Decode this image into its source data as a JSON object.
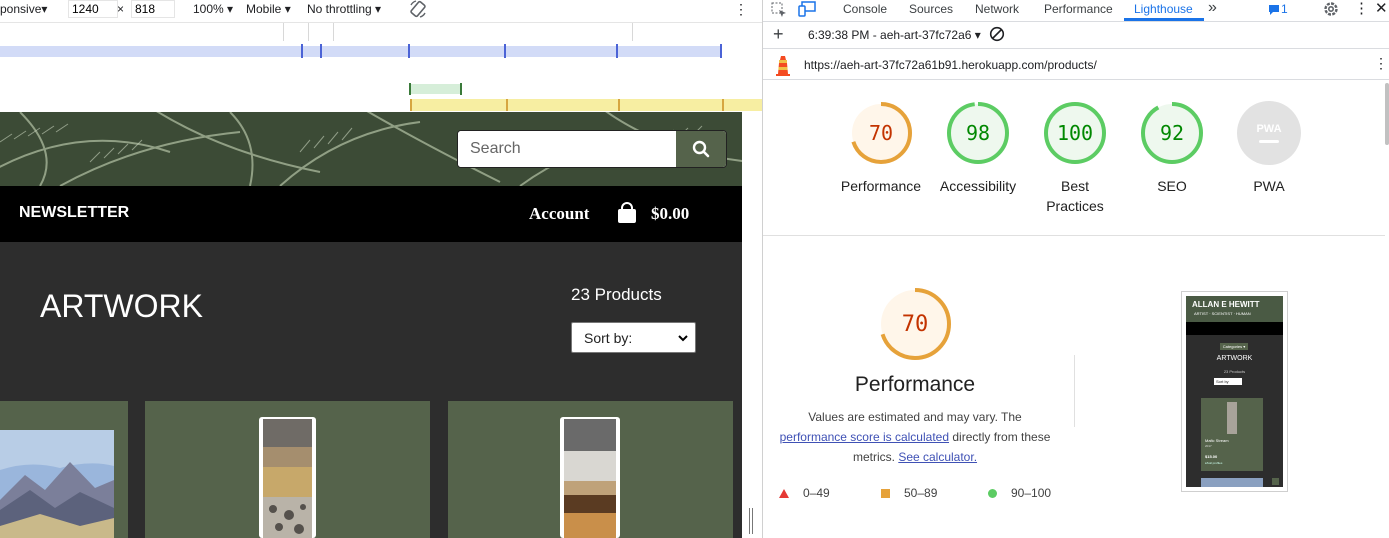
{
  "device_toolbar": {
    "dimensions_label": "ponsive",
    "width": "1240",
    "height": "818",
    "times": "×",
    "zoom": "100%",
    "device": "Mobile",
    "throttling": "No throttling",
    "arrow": "▾"
  },
  "site": {
    "search_placeholder": "Search",
    "nav_newsletter": "NEWSLETTER",
    "nav_account": "Account",
    "nav_total": "$0.00",
    "page_title": "ARTWORK",
    "product_count": "23 Products",
    "sort_label": "Sort by:"
  },
  "devtools": {
    "tabs": [
      "Console",
      "Sources",
      "Network",
      "Performance",
      "Lighthouse"
    ],
    "active_tab": "Lighthouse",
    "more_tabs": "»",
    "issues_count": "1",
    "report_selector": "6:39:38 PM - aeh-art-37fc72a6",
    "page_url": "https://aeh-art-37fc72a61b91.herokuapp.com/products/"
  },
  "lighthouse": {
    "scores": [
      {
        "label": "Performance",
        "value": "70",
        "fraction": 0.7,
        "color": "#e6a23a",
        "text_color": "#c33300",
        "bg": "#fff6ea"
      },
      {
        "label": "Accessibility",
        "value": "98",
        "fraction": 0.98,
        "color": "#5ccc63",
        "text_color": "#008800",
        "bg": "#eef8ee"
      },
      {
        "label": "Best Practices",
        "value": "100",
        "fraction": 1.0,
        "color": "#5ccc63",
        "text_color": "#008800",
        "bg": "#eef8ee"
      },
      {
        "label": "SEO",
        "value": "92",
        "fraction": 0.92,
        "color": "#5ccc63",
        "text_color": "#008800",
        "bg": "#eef8ee"
      },
      {
        "label": "PWA",
        "value": "PWA",
        "fraction": 0,
        "color": "#c8c8c8",
        "text_color": "#ffffff",
        "bg": "#e2e2e2"
      }
    ],
    "detail": {
      "score": "70",
      "title": "Performance",
      "desc_1": "Values are estimated and may vary. The",
      "link_1": "performance score is calculated",
      "desc_2": "directly from these metrics.",
      "link_2": "See calculator."
    },
    "legend": [
      {
        "range": "0–49",
        "color": "#e53935",
        "shape": "triangle"
      },
      {
        "range": "50–89",
        "color": "#e6a23a",
        "shape": "square"
      },
      {
        "range": "90–100",
        "color": "#5ccc63",
        "shape": "circle"
      }
    ],
    "thumbnail": {
      "site_name": "ALLAN E HEWITT",
      "tagline": "ARTIST · SCIENTIST · HUMAN",
      "categories": "Categories ▾",
      "title": "ARTWORK",
      "count": "23 Products",
      "sort": "Sort by",
      "product_name": "Mafic Stream",
      "product_year": "2017",
      "product_price": "$15.00",
      "product_tag": "●Soil profiles"
    }
  }
}
